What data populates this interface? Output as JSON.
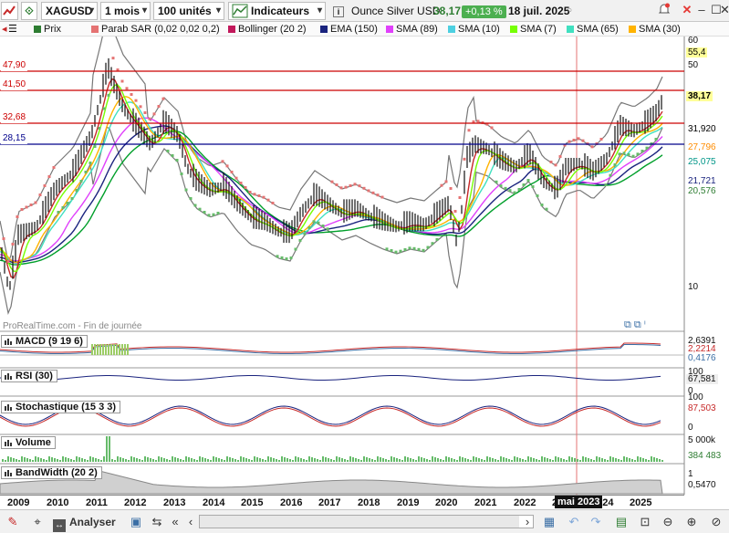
{
  "toolbar": {
    "instrument": "XAGUSD",
    "timeframe": "1 mois",
    "units": "100 unités",
    "indicators_label": "Indicateurs",
    "name": "Ounce Silver USD",
    "price": "38,17",
    "change": "+0,13 %",
    "date": "18 juil. 2025"
  },
  "legend": [
    {
      "label": "Prix",
      "color": "#2e7d32"
    },
    {
      "label": "Parab SAR (0,02 0,02 0,2)",
      "color": "#e57373"
    },
    {
      "label": "Bollinger (20 2)",
      "color": "#c2185b"
    },
    {
      "label": "EMA (150)",
      "color": "#1a237e"
    },
    {
      "label": "SMA (89)",
      "color": "#e040fb"
    },
    {
      "label": "SMA (10)",
      "color": "#4dd0e1"
    },
    {
      "label": "SMA (7)",
      "color": "#76ff03"
    },
    {
      "label": "SMA (65)",
      "color": "#40e0c0"
    },
    {
      "label": "SMA (30)",
      "color": "#ffb300"
    }
  ],
  "price_axis": [
    "60",
    "50",
    "10"
  ],
  "price_labels": [
    {
      "text": "55,4",
      "bg": "#ffff99",
      "fg": "#000000"
    },
    {
      "text": "38,17",
      "bg": "#ffff99",
      "fg": "#000000"
    },
    {
      "text": "31,920",
      "bg": "#ffffff",
      "fg": "#000000"
    },
    {
      "text": "27,796",
      "bg": "#ffffff",
      "fg": "#ff8c00"
    },
    {
      "text": "25,075",
      "bg": "#ffffff",
      "fg": "#009688"
    },
    {
      "text": "21,721",
      "bg": "#ffffff",
      "fg": "#1a237e"
    },
    {
      "text": "20,576",
      "bg": "#ffffff",
      "fg": "#2e7d32"
    }
  ],
  "hlines": [
    {
      "text": "47,90",
      "color": "#cc0000"
    },
    {
      "text": "41,50",
      "color": "#cc0000"
    },
    {
      "text": "32,68",
      "color": "#cc0000"
    },
    {
      "text": "28,15",
      "color": "#00008b"
    }
  ],
  "watermark": "ProRealTime.com - Fin de journée",
  "panels": {
    "macd": {
      "title": "MACD (9 19 6)",
      "values": [
        "2,6391",
        "2,2214",
        "0,4176"
      ]
    },
    "rsi": {
      "title": "RSI (30)",
      "values": [
        "100",
        "67,581",
        "0"
      ]
    },
    "stoch": {
      "title": "Stochastique (15 3 3)",
      "values": [
        "100",
        "87,503",
        "0"
      ]
    },
    "volume": {
      "title": "Volume",
      "values": [
        "5 000k",
        "384 483"
      ]
    },
    "bandwidth": {
      "title": "BandWidth (20 2)",
      "values": [
        "1",
        "0,5470"
      ]
    }
  },
  "years": [
    "2009",
    "2010",
    "2011",
    "2012",
    "2013",
    "2014",
    "2015",
    "2016",
    "2017",
    "2018",
    "2019",
    "2020",
    "2021",
    "2022",
    "2023",
    "2024",
    "2025"
  ],
  "cursor_label": "mai 2023",
  "bottombar": {
    "analyser": "Analyser"
  },
  "icons": {
    "x_close": "close-icon",
    "minimize": "minimize-icon",
    "maximize": "maximize-icon"
  }
}
